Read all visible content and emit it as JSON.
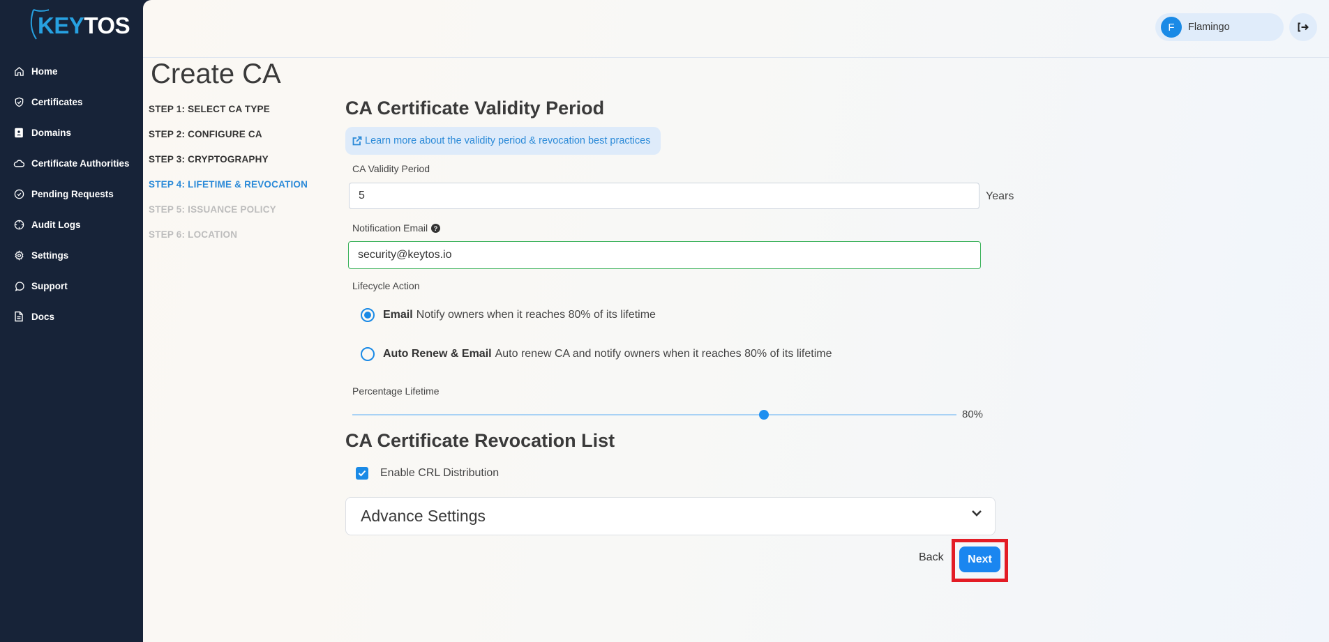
{
  "brand": {
    "name_part1": "KEY",
    "name_part2": "TOS",
    "accent": "#27a1e1"
  },
  "sidebar": {
    "items": [
      {
        "label": "Home",
        "icon": "home-icon"
      },
      {
        "label": "Certificates",
        "icon": "shield-check-icon"
      },
      {
        "label": "Domains",
        "icon": "contact-book-icon"
      },
      {
        "label": "Certificate Authorities",
        "icon": "cloud-icon"
      },
      {
        "label": "Pending Requests",
        "icon": "check-circle-icon"
      },
      {
        "label": "Audit Logs",
        "icon": "crosshair-icon"
      },
      {
        "label": "Settings",
        "icon": "gear-icon"
      },
      {
        "label": "Support",
        "icon": "chat-bubble-icon"
      },
      {
        "label": "Docs",
        "icon": "document-icon"
      }
    ]
  },
  "header": {
    "user_initial": "F",
    "user_name": "Flamingo",
    "logout_icon": "logout-icon"
  },
  "page": {
    "title": "Create CA",
    "steps": [
      {
        "label": "STEP 1: SELECT CA TYPE",
        "state": "done"
      },
      {
        "label": "STEP 2: CONFIGURE CA",
        "state": "done"
      },
      {
        "label": "STEP 3: CRYPTOGRAPHY",
        "state": "done"
      },
      {
        "label": "STEP 4: LIFETIME & REVOCATION",
        "state": "active"
      },
      {
        "label": "STEP 5: ISSUANCE POLICY",
        "state": "disabled"
      },
      {
        "label": "STEP 6: LOCATION",
        "state": "disabled"
      }
    ]
  },
  "validity": {
    "section_title": "CA Certificate Validity Period",
    "info_link": "Learn more about the validity period & revocation best practices",
    "period_label": "CA Validity Period",
    "period_value": "5",
    "period_unit": "Years",
    "email_label": "Notification Email",
    "email_value": "security@keytos.io",
    "lifecycle_label": "Lifecycle Action",
    "options": [
      {
        "title": "Email",
        "description": "Notify owners when it reaches 80% of its lifetime",
        "selected": true
      },
      {
        "title": "Auto Renew & Email",
        "description": "Auto renew CA and notify owners when it reaches 80% of its lifetime",
        "selected": false
      }
    ],
    "percentage_label": "Percentage Lifetime",
    "percentage_value": 80,
    "percentage_display": "80%"
  },
  "revocation": {
    "section_title": "CA Certificate Revocation List",
    "crl_label": "Enable CRL Distribution",
    "crl_checked": true,
    "advanced_title": "Advance Settings"
  },
  "actions": {
    "back_label": "Back",
    "next_label": "Next"
  }
}
